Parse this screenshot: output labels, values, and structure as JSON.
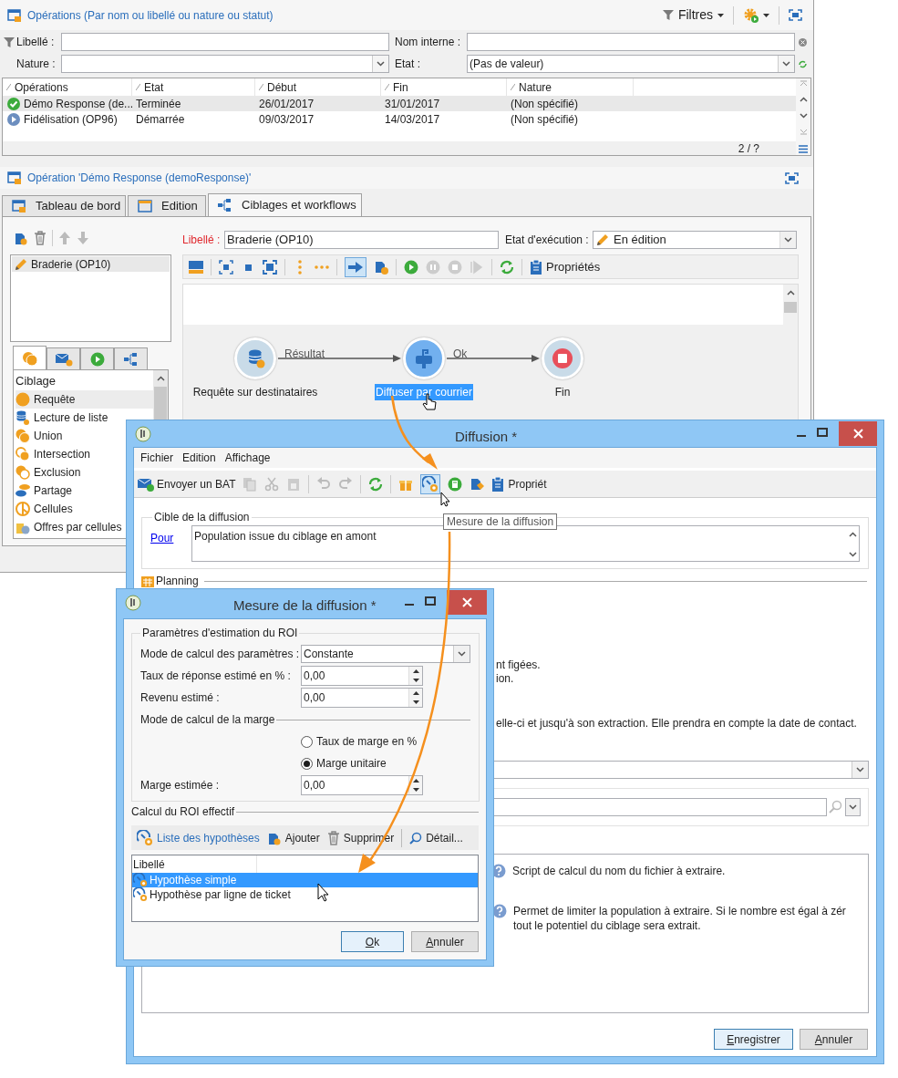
{
  "operations_panel": {
    "title": "Opérations (Par nom ou libellé ou nature ou statut)",
    "filters_button": "Filtres",
    "filter_fields": [
      {
        "label": "Libellé :",
        "kind": "text"
      },
      {
        "label": "Nom interne :",
        "kind": "text"
      },
      {
        "label": "Nature :",
        "kind": "dropdown"
      },
      {
        "label": "Etat :",
        "kind": "dropdown",
        "value": "(Pas de valeur)"
      }
    ],
    "table": {
      "columns": [
        "Opérations",
        "Etat",
        "Début",
        "Fin",
        "Nature"
      ],
      "rows": [
        {
          "kind": "done",
          "selected": true,
          "cells": [
            "Démo Response (de...",
            "Terminée",
            "26/01/2017",
            "31/01/2017",
            "(Non spécifié)"
          ]
        },
        {
          "kind": "running",
          "selected": false,
          "cells": [
            "Fidélisation (OP96)",
            "Démarrée",
            "09/03/2017",
            "14/03/2017",
            "(Non spécifié)"
          ]
        }
      ],
      "pager": "2 / ?"
    }
  },
  "operation": {
    "title": "Opération 'Démo Response (demoResponse)'",
    "tabs": [
      {
        "label": "Tableau de bord",
        "selected": false
      },
      {
        "label": "Edition",
        "selected": false
      },
      {
        "label": "Ciblages et workflows",
        "selected": true
      }
    ],
    "campaigns": [
      {
        "label": "Braderie (OP10)",
        "selected": true
      }
    ],
    "palette_tabs": [
      {
        "selected": true
      },
      {
        "selected": false
      },
      {
        "selected": false
      },
      {
        "selected": false
      }
    ],
    "palette": {
      "header": "Ciblage",
      "items": [
        {
          "label": "Requête",
          "selected": true
        },
        {
          "label": "Lecture de liste",
          "selected": false
        },
        {
          "label": "Union",
          "selected": false
        },
        {
          "label": "Intersection",
          "selected": false
        },
        {
          "label": "Exclusion",
          "selected": false
        },
        {
          "label": "Partage",
          "selected": false
        },
        {
          "label": "Cellules",
          "selected": false
        },
        {
          "label": "Offres par cellules",
          "selected": false
        }
      ]
    },
    "label_field": {
      "label": "Libellé :",
      "value": "Braderie (OP10)"
    },
    "execution_state": {
      "label": "Etat d'exécution :",
      "value": "En édition"
    },
    "properties_button": "Propriétés",
    "workflow": {
      "nodes": [
        {
          "label": "Requête sur destinataires",
          "kind": "query",
          "selected": false
        },
        {
          "label": "Diffuser par courrier",
          "kind": "mail",
          "selected": true
        },
        {
          "label": "Fin",
          "kind": "end",
          "selected": false
        }
      ],
      "transitions": [
        "Résultat",
        "Ok"
      ]
    }
  },
  "diffusion_window": {
    "title": "Diffusion *",
    "menu": [
      "Fichier",
      "Edition",
      "Affichage"
    ],
    "send_button": "Envoyer un BAT",
    "properties_button": "Propriét",
    "tooltip": "Mesure de la diffusion",
    "target_group": "Cible de la diffusion",
    "target_link": "Pour",
    "target_value": "Population issue du ciblage en amont",
    "planning": "Planning",
    "visible_fragments": [
      "nt figées.",
      "ion.",
      "elle-ci et jusqu'à son extraction. Elle prendra en compte la date de contact."
    ],
    "help_texts": [
      "Script de calcul du nom du fichier à extraire.",
      "Permet de limiter la population à extraire. Si le nombre est égal à zér\ntout le potentiel du ciblage sera extrait."
    ],
    "buttons": [
      "Enregistrer",
      "Annuler"
    ]
  },
  "measure_dialog": {
    "title": "Mesure de la diffusion *",
    "group": "Paramètres d'estimation du ROI",
    "fields": [
      {
        "label": "Mode de calcul des paramètres :",
        "kind": "dropdown",
        "value": "Constante"
      },
      {
        "label": "Taux de réponse estimé en % :",
        "kind": "spin",
        "value": "0,00"
      },
      {
        "label": "Revenu estimé :",
        "kind": "spin",
        "value": "0,00"
      }
    ],
    "margin_section": "Mode de calcul de la marge",
    "margin_modes": [
      {
        "label": "Taux de marge en %",
        "selected": false
      },
      {
        "label": "Marge unitaire",
        "selected": true
      }
    ],
    "margin_field": {
      "label": "Marge estimée :",
      "kind": "spin",
      "value": "0,00"
    },
    "roi_section": "Calcul du ROI effectif",
    "toolbar": [
      {
        "label": "Liste des hypothèses",
        "kind": "link"
      },
      {
        "label": "Ajouter",
        "kind": "add"
      },
      {
        "label": "Supprimer",
        "kind": "delete"
      },
      {
        "label": "Détail...",
        "kind": "detail"
      }
    ],
    "list": {
      "column": "Libellé",
      "rows": [
        {
          "label": "Hypothèse simple",
          "selected": true
        },
        {
          "label": "Hypothèse par ligne de ticket",
          "selected": false
        }
      ]
    },
    "buttons": [
      "Ok",
      "Annuler"
    ]
  }
}
